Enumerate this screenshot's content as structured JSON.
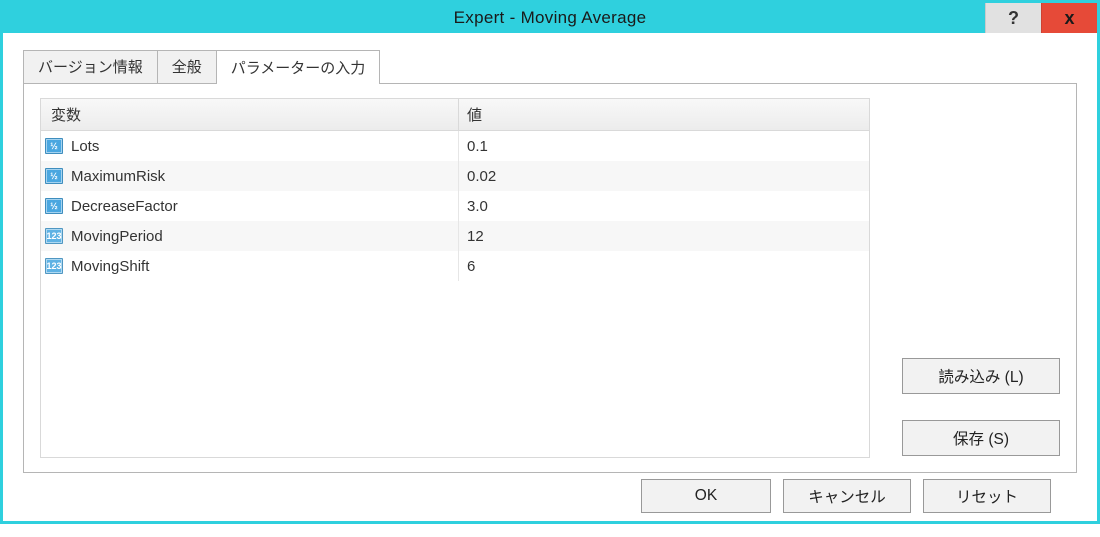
{
  "window": {
    "title": "Expert - Moving Average"
  },
  "titlebar": {
    "help": "?",
    "close": "x"
  },
  "tabs": [
    {
      "label": "バージョン情報",
      "active": false
    },
    {
      "label": "全般",
      "active": false
    },
    {
      "label": "パラメーターの入力",
      "active": true
    }
  ],
  "table": {
    "headers": {
      "variable": "変数",
      "value": "値"
    },
    "rows": [
      {
        "icon": "double",
        "iconText": "½",
        "name": "Lots",
        "value": "0.1"
      },
      {
        "icon": "double",
        "iconText": "½",
        "name": "MaximumRisk",
        "value": "0.02"
      },
      {
        "icon": "double",
        "iconText": "½",
        "name": "DecreaseFactor",
        "value": "3.0"
      },
      {
        "icon": "int",
        "iconText": "123",
        "name": "MovingPeriod",
        "value": "12"
      },
      {
        "icon": "int",
        "iconText": "123",
        "name": "MovingShift",
        "value": "6"
      }
    ]
  },
  "buttons": {
    "load": "読み込み (L)",
    "save": "保存 (S)",
    "ok": "OK",
    "cancel": "キャンセル",
    "reset": "リセット"
  }
}
